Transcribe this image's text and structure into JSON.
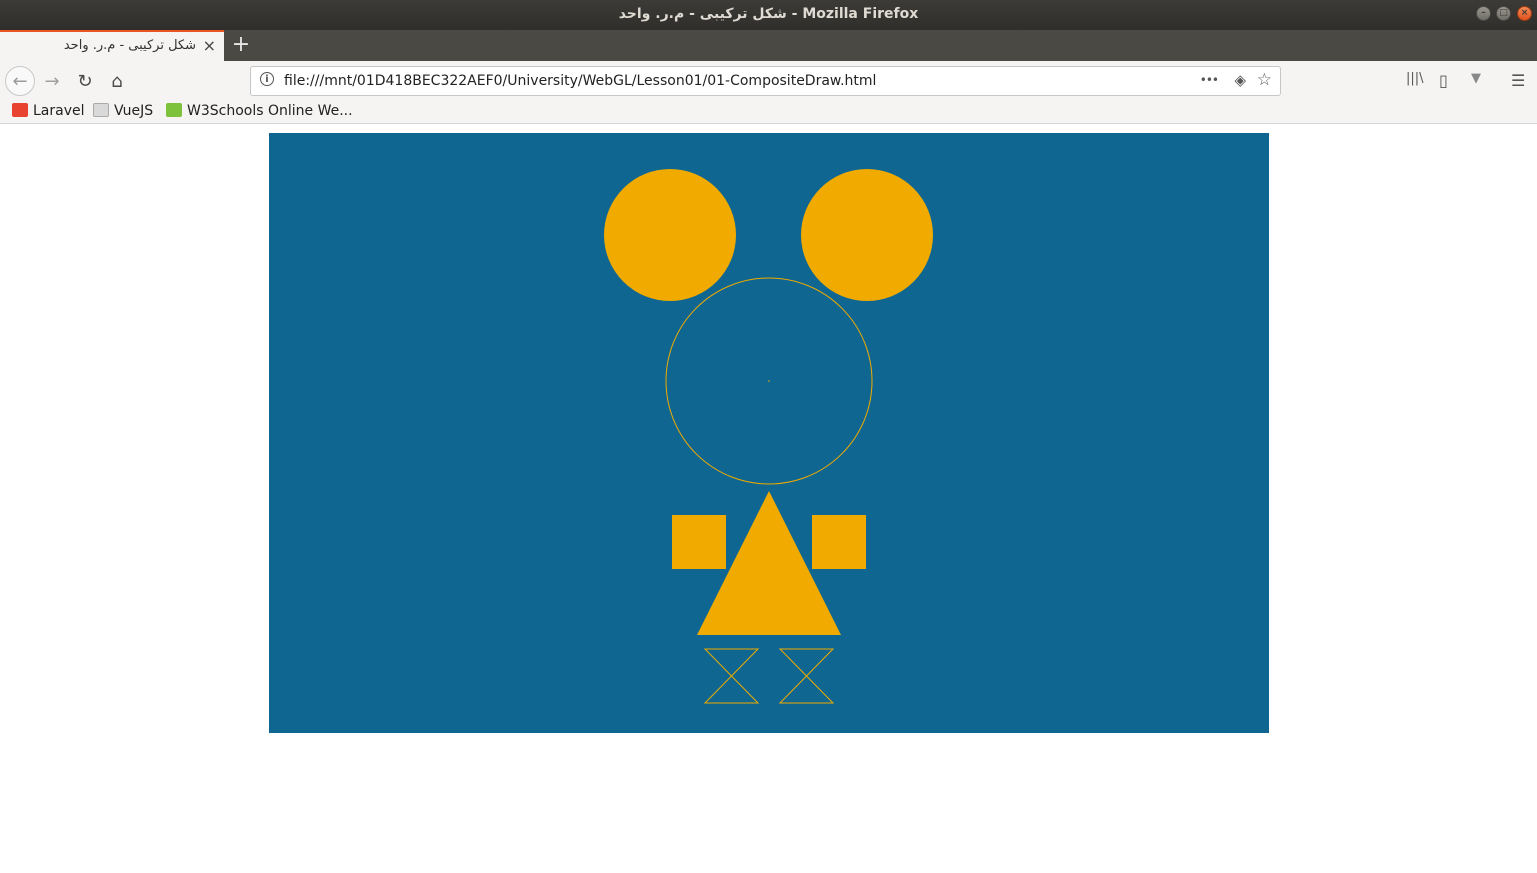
{
  "window": {
    "title": "شکل ترکیبی - م.ر. واحد - Mozilla Firefox"
  },
  "tab": {
    "title": "شکل ترکیبی - م.ر. واحد",
    "close": "×",
    "new_tab": "+"
  },
  "nav": {
    "back": "←",
    "forward": "→",
    "reload": "↻",
    "home": "⌂",
    "url": "file:///mnt/01D418BEC322AEF0/University/WebGL/Lesson01/01-CompositeDraw.html",
    "info": "i",
    "page_actions": "•••",
    "pocket": "◈",
    "bookmark_star": "☆",
    "library": "|||\\",
    "sidebar": "▯",
    "extension": "▼",
    "menu": "☰"
  },
  "bookmarks": [
    {
      "label": "Laravel",
      "icon": "laravel-icon",
      "color": "#e8432e"
    },
    {
      "label": "VueJS",
      "icon": "page-icon",
      "color": "#cfcfcf"
    },
    {
      "label": "W3Schools Online We...",
      "icon": "w3schools-icon",
      "color": "#7ec13a"
    }
  ],
  "canvas": {
    "background": "#0f6791",
    "shape_color": "#f0aa00"
  }
}
